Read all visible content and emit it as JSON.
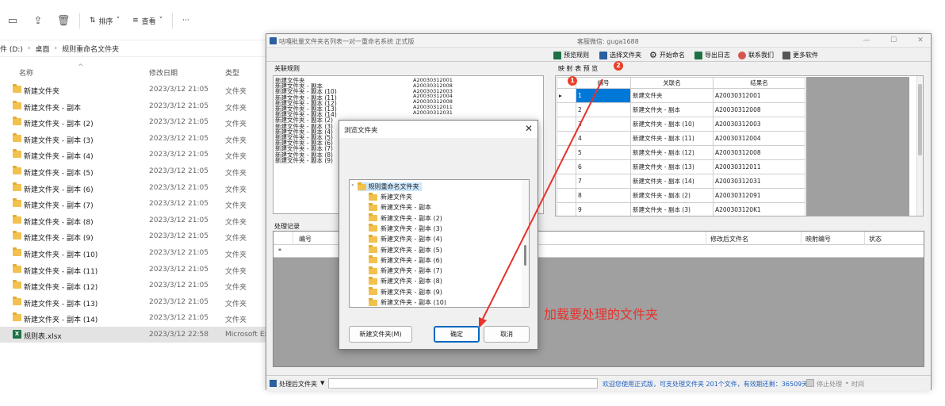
{
  "explorer": {
    "toolbar": {
      "sort": "排序",
      "view": "查看",
      "more": "···"
    },
    "breadcrumb": [
      "件 (D:)",
      "桌面",
      "规则重命名文件夹"
    ],
    "columns": {
      "name": "名称",
      "modified": "修改日期",
      "type": "类型"
    },
    "files": [
      {
        "name": "新建文件夹",
        "date": "2023/3/12 21:05",
        "type": "文件夹"
      },
      {
        "name": "新建文件夹 - 副本",
        "date": "2023/3/12 21:05",
        "type": "文件夹"
      },
      {
        "name": "新建文件夹 - 副本 (2)",
        "date": "2023/3/12 21:05",
        "type": "文件夹"
      },
      {
        "name": "新建文件夹 - 副本 (3)",
        "date": "2023/3/12 21:05",
        "type": "文件夹"
      },
      {
        "name": "新建文件夹 - 副本 (4)",
        "date": "2023/3/12 21:05",
        "type": "文件夹"
      },
      {
        "name": "新建文件夹 - 副本 (5)",
        "date": "2023/3/12 21:05",
        "type": "文件夹"
      },
      {
        "name": "新建文件夹 - 副本 (6)",
        "date": "2023/3/12 21:05",
        "type": "文件夹"
      },
      {
        "name": "新建文件夹 - 副本 (7)",
        "date": "2023/3/12 21:05",
        "type": "文件夹"
      },
      {
        "name": "新建文件夹 - 副本 (8)",
        "date": "2023/3/12 21:05",
        "type": "文件夹"
      },
      {
        "name": "新建文件夹 - 副本 (9)",
        "date": "2023/3/12 21:05",
        "type": "文件夹"
      },
      {
        "name": "新建文件夹 - 副本 (10)",
        "date": "2023/3/12 21:05",
        "type": "文件夹"
      },
      {
        "name": "新建文件夹 - 副本 (11)",
        "date": "2023/3/12 21:05",
        "type": "文件夹"
      },
      {
        "name": "新建文件夹 - 副本 (12)",
        "date": "2023/3/12 21:05",
        "type": "文件夹"
      },
      {
        "name": "新建文件夹 - 副本 (13)",
        "date": "2023/3/12 21:05",
        "type": "文件夹"
      },
      {
        "name": "新建文件夹 - 副本 (14)",
        "date": "2023/3/12 21:05",
        "type": "文件夹"
      },
      {
        "name": "规则表.xlsx",
        "date": "2023/3/12 22:58",
        "type": "Microsoft Exc"
      }
    ]
  },
  "app": {
    "title": "咕嘎批量文件夹名列表一对一重命名系统  正式版",
    "contact": "客服微信: guga1688",
    "toolbar": [
      "预览规则",
      "选择文件夹",
      "开始命名",
      "导出日志",
      "联系我们",
      "更多软件"
    ],
    "rules_label": "关联规则",
    "rules_left": [
      "新建文件夹",
      "新建文件夹 - 副本",
      "新建文件夹 - 副本 (10)",
      "新建文件夹 - 副本 (11)",
      "新建文件夹 - 副本 (12)",
      "新建文件夹 - 副本 (13)",
      "新建文件夹 - 副本 (14)",
      "新建文件夹 - 副本 (2)",
      "新建文件夹 - 副本 (3)",
      "新建文件夹 - 副本 (4)",
      "新建文件夹 - 副本 (5)",
      "新建文件夹 - 副本 (6)",
      "新建文件夹 - 副本 (7)",
      "新建文件夹 - 副本 (8)",
      "新建文件夹 - 副本 (9)"
    ],
    "rules_right": [
      "A20030312001",
      "A20030312008",
      "A20030312003",
      "A20030312004",
      "A20030312008",
      "A20030312011",
      "A20030312031"
    ],
    "preview_label": "映 射 表 预 览",
    "preview_headers": [
      "编号",
      "关联名",
      "结果名"
    ],
    "preview_rows": [
      {
        "num": "1",
        "name": "新建文件夹",
        "result": "A20030312001"
      },
      {
        "num": "2",
        "name": "新建文件夹 - 副本",
        "result": "A20030312008"
      },
      {
        "num": "3",
        "name": "新建文件夹 - 副本 (10)",
        "result": "A20030312003"
      },
      {
        "num": "4",
        "name": "新建文件夹 - 副本 (11)",
        "result": "A20030312004"
      },
      {
        "num": "5",
        "name": "新建文件夹 - 副本 (12)",
        "result": "A20030312008"
      },
      {
        "num": "6",
        "name": "新建文件夹 - 副本 (13)",
        "result": "A20030312011"
      },
      {
        "num": "7",
        "name": "新建文件夹 - 副本 (14)",
        "result": "A20030312031"
      },
      {
        "num": "8",
        "name": "新建文件夹 - 副本 (2)",
        "result": "A20030312091"
      },
      {
        "num": "9",
        "name": "新建文件夹 - 副本 (3)",
        "result": "A200303120K1"
      }
    ],
    "log_label": "处理记录",
    "log_headers": [
      "编号",
      "修改后文件名",
      "映射编号",
      "状态"
    ],
    "log_new_row": "*",
    "status": {
      "folder_select": "处理后文件夹",
      "message": "欢迎您使用正式版，可支处理文件夹 201个文件，有效期还剩：36509天",
      "stop": "停止处理",
      "time": "时间"
    }
  },
  "dialog": {
    "title": "浏览文件夹",
    "root": "规则重命名文件夹",
    "items": [
      "新建文件夹",
      "新建文件夹 - 副本",
      "新建文件夹 - 副本 (2)",
      "新建文件夹 - 副本 (3)",
      "新建文件夹 - 副本 (4)",
      "新建文件夹 - 副本 (5)",
      "新建文件夹 - 副本 (6)",
      "新建文件夹 - 副本 (7)",
      "新建文件夹 - 副本 (8)",
      "新建文件夹 - 副本 (9)",
      "新建文件夹 - 副本 (10)"
    ],
    "new_folder": "新建文件夹(M)",
    "ok": "确定",
    "cancel": "取消"
  },
  "annotations": {
    "badge1": "1",
    "badge2": "2",
    "hint": "加载要处理的文件夹",
    "color": "#e8322a"
  }
}
